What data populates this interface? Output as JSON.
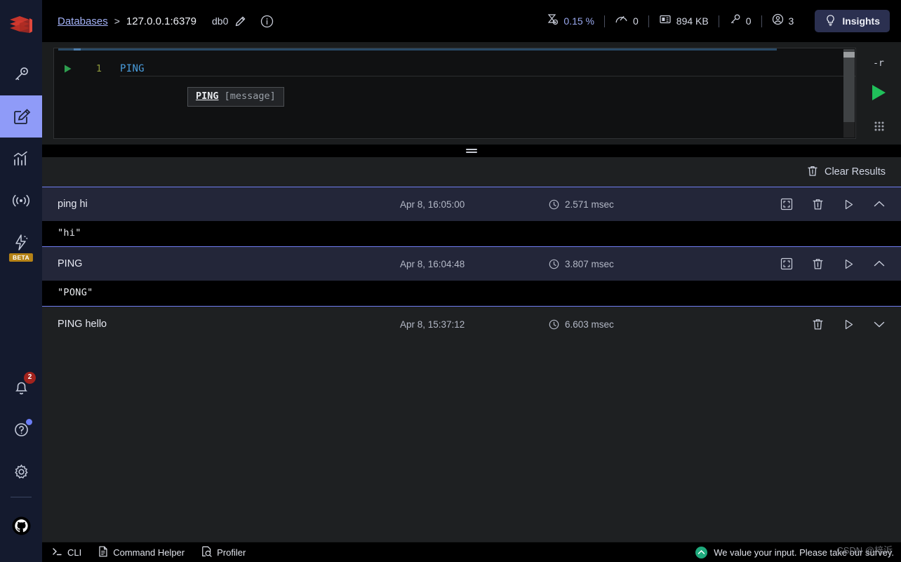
{
  "sidebar": {
    "logo": "redis-logo",
    "items": [
      {
        "name": "browser",
        "icon": "key-icon",
        "active": false
      },
      {
        "name": "workbench",
        "icon": "edit-note-icon",
        "active": true
      },
      {
        "name": "analysis-tools",
        "icon": "bar-chart-icon",
        "active": false
      },
      {
        "name": "pub-sub",
        "icon": "broadcast-icon",
        "active": false
      },
      {
        "name": "triggers-and-functions",
        "icon": "lightning-gear-icon",
        "active": false,
        "badge": "BETA"
      }
    ],
    "bottom": [
      {
        "name": "notifications",
        "icon": "bell-icon",
        "badge": "2"
      },
      {
        "name": "help",
        "icon": "question-circle-icon",
        "dot": true
      },
      {
        "name": "settings",
        "icon": "gear-icon"
      },
      {
        "name": "github",
        "icon": "github-icon"
      }
    ]
  },
  "header": {
    "breadcrumb_link": "Databases",
    "breadcrumb_separator": ">",
    "host": "127.0.0.1:6379",
    "db_index": "db0",
    "edit_icon": "pencil-icon",
    "info_icon": "info-circle-icon",
    "metrics": [
      {
        "icon": "cpu-icon",
        "value": "0.15 %",
        "accent": true
      },
      {
        "icon": "speedometer-icon",
        "value": "0"
      },
      {
        "icon": "memory-icon",
        "value": "894 KB"
      },
      {
        "icon": "key-icon",
        "value": "0"
      },
      {
        "icon": "user-icon",
        "value": "3"
      }
    ],
    "insights": {
      "label": "Insights",
      "icon": "bulb-icon"
    }
  },
  "editor": {
    "line_number": "1",
    "code": "PING",
    "run_line_icon": "play-triangle-icon",
    "tooltip": {
      "command": "PING",
      "args": "[message]"
    },
    "rail": {
      "raw_mode_label": "-r",
      "run_icon": "play-triangle-icon",
      "grip_icon": "drag-grip-icon"
    }
  },
  "resizer": {
    "icon": "horizontal-resize-handle"
  },
  "results": {
    "clear_label": "Clear Results",
    "clear_icon": "trash-icon",
    "rows": [
      {
        "command": "ping hi",
        "timestamp": "Apr 8, 16:05:00",
        "duration": "2.571 msec",
        "output": "\"hi\"",
        "expanded": true,
        "actions": [
          "fullscreen-icon",
          "trash-icon",
          "play-icon",
          "chevron-up-icon"
        ]
      },
      {
        "command": "PING",
        "timestamp": "Apr 8, 16:04:48",
        "duration": "3.807 msec",
        "output": "\"PONG\"",
        "expanded": true,
        "actions": [
          "fullscreen-icon",
          "trash-icon",
          "play-icon",
          "chevron-up-icon"
        ]
      },
      {
        "command": "PING hello",
        "timestamp": "Apr 8, 15:37:12",
        "duration": "6.603 msec",
        "output": "",
        "expanded": false,
        "actions": [
          "trash-icon",
          "play-icon",
          "chevron-down-icon"
        ]
      }
    ],
    "clock_icon": "clock-icon"
  },
  "bottombar": {
    "items": [
      {
        "label": "CLI",
        "icon": "terminal-prompt-icon"
      },
      {
        "label": "Command Helper",
        "icon": "document-icon"
      },
      {
        "label": "Profiler",
        "icon": "magnifier-doc-icon"
      }
    ],
    "survey": {
      "text": "We value your input. Please take our survey.",
      "icon": "survey-badge-icon"
    },
    "watermark": "CSDN @梓沂"
  },
  "colors": {
    "accent_blue": "#8f9bf8",
    "sidebar_bg": "#141a2e",
    "row_bg": "#232639",
    "output_bg": "#000000",
    "run_green": "#2ecc5e"
  }
}
